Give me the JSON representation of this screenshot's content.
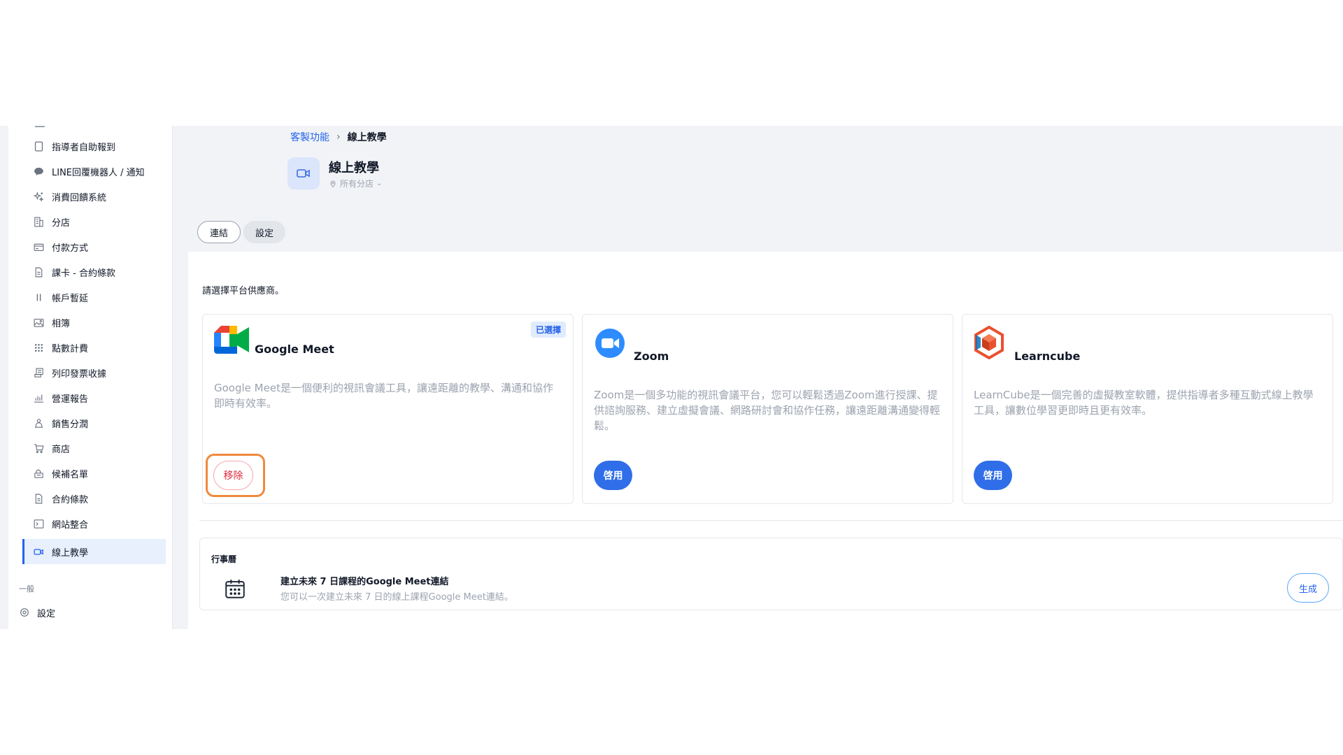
{
  "breadcrumb": {
    "parent": "客製功能",
    "current": "線上教學"
  },
  "page": {
    "title": "線上教學",
    "branch": "所有分店"
  },
  "tabs": [
    {
      "label": "連結"
    },
    {
      "label": "設定"
    }
  ],
  "sidebar": {
    "items": [
      {
        "label": "指導者自助報到",
        "icon": "tablet-icon"
      },
      {
        "label": "LINE回覆機器人 / 通知",
        "icon": "chat-bubble-icon"
      },
      {
        "label": "消費回饋系統",
        "icon": "sparkle-icon"
      },
      {
        "label": "分店",
        "icon": "building-icon"
      },
      {
        "label": "付款方式",
        "icon": "credit-card-icon"
      },
      {
        "label": "課卡 - 合約條款",
        "icon": "document-icon"
      },
      {
        "label": "帳戶暫延",
        "icon": "pause-icon"
      },
      {
        "label": "相簿",
        "icon": "photo-album-icon"
      },
      {
        "label": "點數計費",
        "icon": "dots-grid-icon"
      },
      {
        "label": "列印發票收據",
        "icon": "printer-receipt-icon"
      },
      {
        "label": "營運報告",
        "icon": "bar-chart-icon"
      },
      {
        "label": "銷售分潤",
        "icon": "people-share-icon"
      },
      {
        "label": "商店",
        "icon": "cart-icon"
      },
      {
        "label": "候補名單",
        "icon": "waitlist-icon"
      },
      {
        "label": "合約條款",
        "icon": "document-icon"
      },
      {
        "label": "網站整合",
        "icon": "terminal-icon"
      },
      {
        "label": "線上教學",
        "icon": "video-camera-icon",
        "active": true
      }
    ],
    "section_general": "一般",
    "settings_label": "設定"
  },
  "providers": {
    "prompt": "請選擇平台供應商。",
    "google_meet": {
      "name": "Google Meet",
      "badge": "已選擇",
      "description": "Google Meet是一個便利的視訊會議工具，讓遠距離的教學、溝通和協作即時有效率。",
      "action": "移除"
    },
    "zoom": {
      "name": "Zoom",
      "description": "Zoom是一個多功能的視訊會議平台，您可以輕鬆透過Zoom進行授課、提供諮詢服務、建立虛擬會議、網路研討會和協作任務，讓遠距離溝通變得輕鬆。",
      "action": "啓用"
    },
    "learncube": {
      "name": "Learncube",
      "description": "LearnCube是一個完善的虛擬教室軟體，提供指導者多種互動式線上教學工具，讓數位學習更即時且更有效率。",
      "action": "啓用"
    }
  },
  "calendar": {
    "heading": "行事曆",
    "title": "建立未來 7 日課程的Google Meet連結",
    "subtitle": "您可以一次建立未來 7 日的線上課程Google Meet連結。",
    "action": "生成"
  },
  "colors": {
    "accent": "#2f6ee8",
    "remove": "#e0283a",
    "highlight_ring": "#f08a3c",
    "active_bg": "#e8effd"
  }
}
